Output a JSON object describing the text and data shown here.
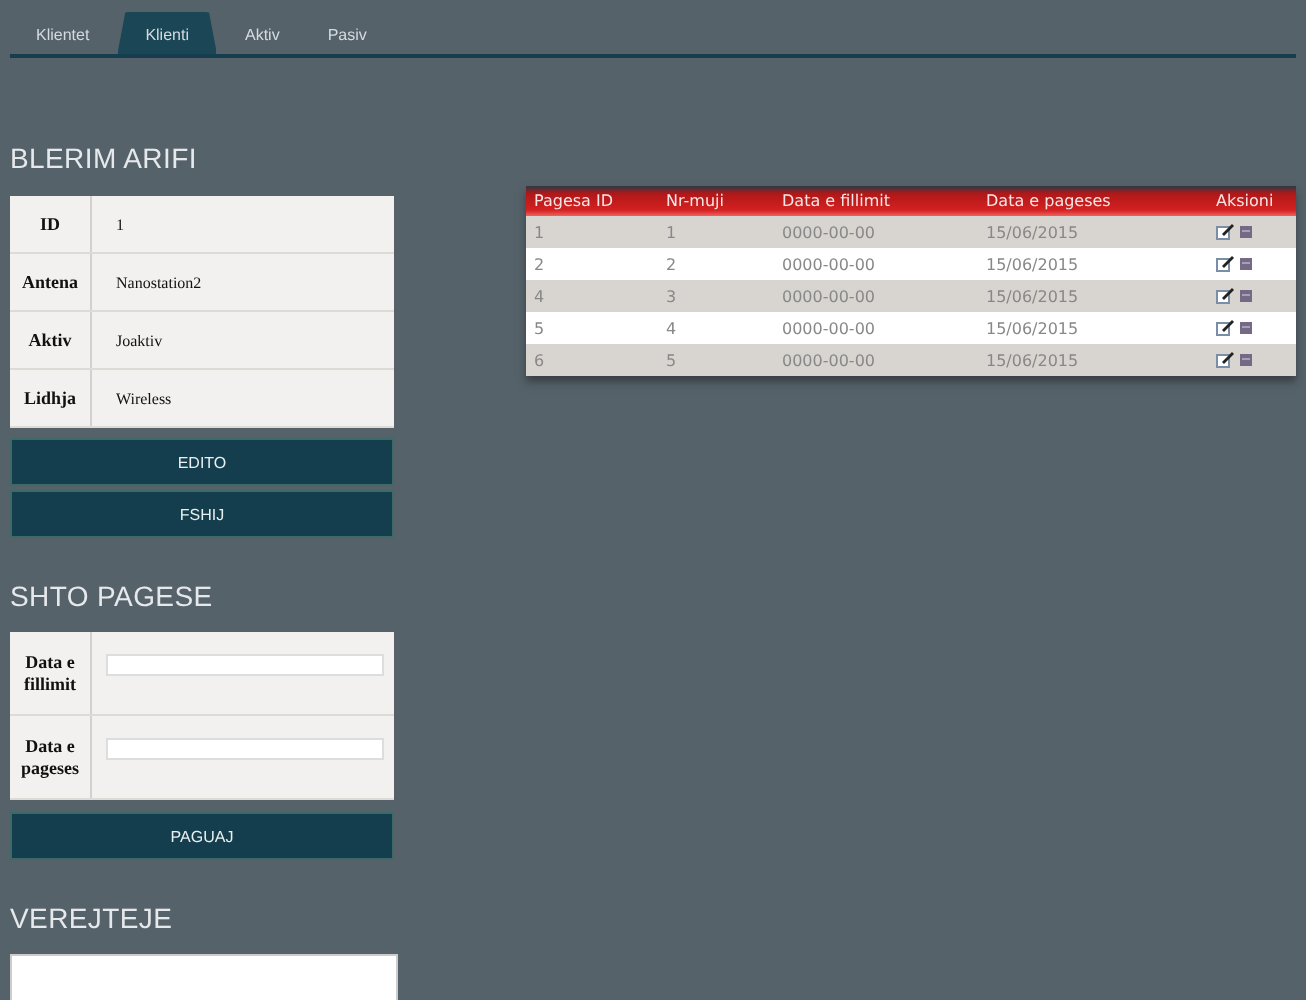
{
  "tabs": [
    {
      "label": "Klientet",
      "selected": false
    },
    {
      "label": "Klienti",
      "selected": true
    },
    {
      "label": "Aktiv",
      "selected": false
    },
    {
      "label": "Pasiv",
      "selected": false
    }
  ],
  "client": {
    "title": "BLERIM ARIFI",
    "fields": [
      {
        "label": "ID",
        "value": "1"
      },
      {
        "label": "Antena",
        "value": "Nanostation2"
      },
      {
        "label": "Aktiv",
        "value": "Joaktiv"
      },
      {
        "label": "Lidhja",
        "value": "Wireless"
      }
    ],
    "buttons": [
      "EDITO",
      "FSHIJ"
    ]
  },
  "add_payment": {
    "title": "SHTO PAGESE",
    "fields": [
      {
        "label": "Data e fillimit"
      },
      {
        "label": "Data e pageses"
      }
    ],
    "button": "PAGUAJ"
  },
  "notes": {
    "title": "VEREJTEJE"
  },
  "payments": {
    "columns": [
      "Pagesa ID",
      "Nr-muji",
      "Data e fillimit",
      "Data e pageses",
      "Aksioni"
    ],
    "rows": [
      {
        "cells": [
          "1",
          "1",
          "0000-00-00",
          "15/06/2015"
        ]
      },
      {
        "cells": [
          "2",
          "2",
          "0000-00-00",
          "15/06/2015"
        ]
      },
      {
        "cells": [
          "4",
          "3",
          "0000-00-00",
          "15/06/2015"
        ]
      },
      {
        "cells": [
          "5",
          "4",
          "0000-00-00",
          "15/06/2015"
        ]
      },
      {
        "cells": [
          "6",
          "5",
          "0000-00-00",
          "15/06/2015"
        ]
      }
    ]
  }
}
